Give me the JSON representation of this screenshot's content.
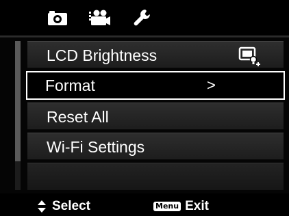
{
  "tabs": [
    {
      "icon": "camera-icon",
      "active": true
    },
    {
      "icon": "video-camera-icon",
      "active": false
    },
    {
      "icon": "wrench-icon",
      "active": false
    }
  ],
  "menu": {
    "items": [
      {
        "label": "LCD Brightness",
        "selected": false,
        "indicator": "lcd-brightness-icon"
      },
      {
        "label": "Format",
        "selected": true,
        "indicator": ">"
      },
      {
        "label": "Reset All",
        "selected": false
      },
      {
        "label": "Wi-Fi Settings",
        "selected": false
      }
    ]
  },
  "hints": {
    "select_label": "Select",
    "menu_key": "Menu",
    "exit_label": "Exit"
  },
  "colors": {
    "background": "#000000",
    "row": "#2a2a2a",
    "highlight_border": "#ffffff",
    "text": "#ffffff"
  }
}
